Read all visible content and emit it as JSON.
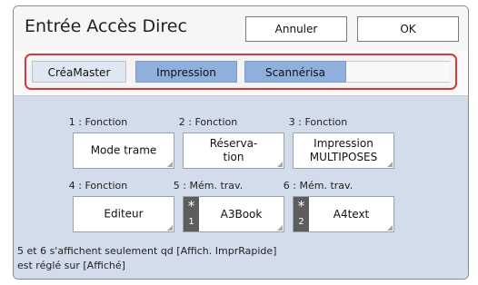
{
  "header": {
    "title": "Entrée Accès Direc",
    "cancel_label": "Annuler",
    "ok_label": "OK"
  },
  "tabs": [
    {
      "label": "CréaMaster",
      "active": true
    },
    {
      "label": "Impression",
      "active": false
    },
    {
      "label": "Scannérisa",
      "active": false
    }
  ],
  "functions": [
    {
      "label": "1 : Fonction",
      "button": [
        "Mode trame"
      ]
    },
    {
      "label": "2 : Fonction",
      "button": [
        "Réserva-",
        "tion"
      ]
    },
    {
      "label": "3 : Fonction",
      "button": [
        "Impression",
        "MULTIPOSES"
      ]
    },
    {
      "label": "4 : Fonction",
      "button": [
        "Editeur"
      ]
    },
    {
      "label": "5 : Mém. trav.",
      "memory_number": "1",
      "button": [
        "A3Book"
      ]
    },
    {
      "label": "6 : Mém. trav.",
      "memory_number": "2",
      "button": [
        "A4text"
      ]
    }
  ],
  "memory_badge_symbol": "*",
  "note": [
    "5 et 6 s'affichent seulement qd [Affich. ImprRapide]",
    "est réglé sur [Affiché]"
  ],
  "colors": {
    "highlight_frame": "#d8373b",
    "tab_inactive": "#8fb0dd",
    "content_background": "#d3dceb",
    "memory_badge": "#5d5d5d"
  }
}
